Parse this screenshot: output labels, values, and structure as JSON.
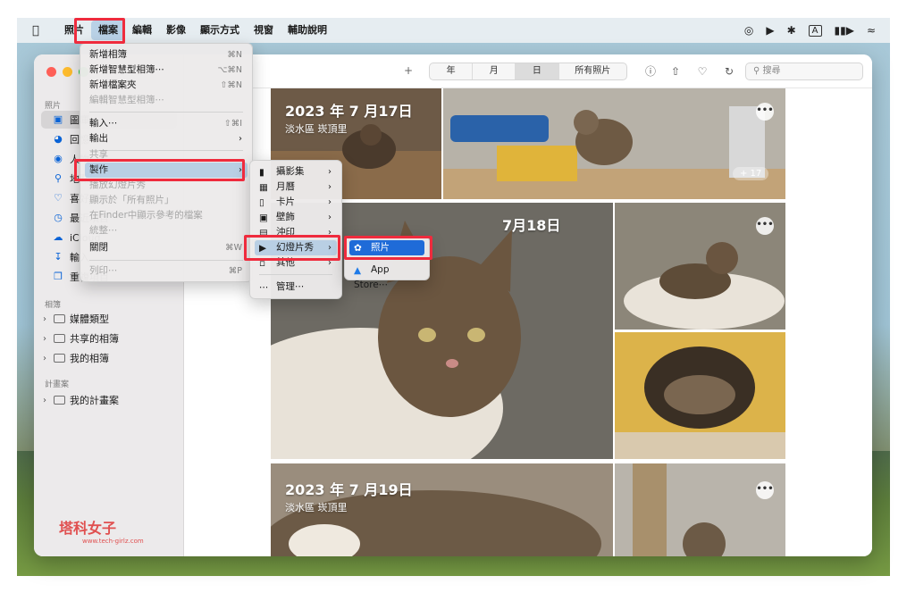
{
  "menubar": {
    "app": "照片",
    "items": [
      "檔案",
      "編輯",
      "影像",
      "顯示方式",
      "視窗",
      "輔助說明"
    ],
    "status_icons": [
      "airplay-icon",
      "play-icon",
      "bluetooth-icon",
      "input-icon",
      "battery-icon",
      "wifi-icon"
    ],
    "input_label": "A"
  },
  "sidebar": {
    "section_photos": "照片",
    "items": [
      {
        "label": "圖庫",
        "icon": "photos-icon"
      },
      {
        "label": "回憶",
        "icon": "memories-icon"
      },
      {
        "label": "人物",
        "icon": "people-icon"
      },
      {
        "label": "地點",
        "icon": "places-icon"
      },
      {
        "label": "喜好項目",
        "icon": "heart-icon"
      },
      {
        "label": "最近項目",
        "icon": "clock-icon"
      },
      {
        "label": "iCloud",
        "icon": "cloud-icon"
      },
      {
        "label": "輸入",
        "icon": "import-icon"
      },
      {
        "label": "重複項目",
        "icon": "duplicate-icon"
      }
    ],
    "section_albums": "相簿",
    "albums": [
      "媒體類型",
      "共享的相簿",
      "我的相簿"
    ],
    "section_projects": "計畫案",
    "projects": [
      "我的計畫案"
    ]
  },
  "toolbar": {
    "segments": [
      "年",
      "月",
      "日",
      "所有照片"
    ],
    "active_segment": "日",
    "search_placeholder": "搜尋"
  },
  "days": [
    {
      "title": "2023 年 7 月17日",
      "location": "淡水區 崁頂里",
      "more_count": "+ 17"
    },
    {
      "title": "7月18日",
      "location": ""
    },
    {
      "title": "2023 年 7 月19日",
      "location": "淡水區 崁頂里"
    }
  ],
  "file_menu": {
    "items": [
      {
        "label": "新增相簿",
        "shortcut": "⌘N",
        "disabled": false
      },
      {
        "label": "新增智慧型相簿⋯",
        "shortcut": "⌥⌘N",
        "disabled": false
      },
      {
        "label": "新增檔案夾",
        "shortcut": "⇧⌘N",
        "disabled": false
      },
      {
        "label": "編輯智慧型相簿⋯",
        "shortcut": "",
        "disabled": true
      },
      {
        "label": "輸入⋯",
        "shortcut": "⇧⌘I",
        "disabled": false
      },
      {
        "label": "輸出",
        "shortcut": "",
        "disabled": false
      },
      {
        "label": "共享",
        "shortcut": "",
        "disabled": true
      },
      {
        "label": "製作",
        "shortcut": "",
        "disabled": false
      },
      {
        "label": "播放幻燈片秀",
        "shortcut": "",
        "disabled": true
      },
      {
        "label": "顯示於「所有照片」",
        "shortcut": "",
        "disabled": true
      },
      {
        "label": "在Finder中顯示參考的檔案",
        "shortcut": "",
        "disabled": true
      },
      {
        "label": "統整⋯",
        "shortcut": "",
        "disabled": true
      },
      {
        "label": "關閉",
        "shortcut": "⌘W",
        "disabled": false
      },
      {
        "label": "列印⋯",
        "shortcut": "⌘P",
        "disabled": true
      }
    ]
  },
  "create_menu": {
    "items": [
      {
        "label": "攝影集",
        "icon": "book-icon"
      },
      {
        "label": "月曆",
        "icon": "calendar-icon"
      },
      {
        "label": "卡片",
        "icon": "card-icon"
      },
      {
        "label": "壁飾",
        "icon": "wall-decor-icon"
      },
      {
        "label": "沖印",
        "icon": "prints-icon"
      },
      {
        "label": "幻燈片秀",
        "icon": "slideshow-icon"
      },
      {
        "label": "其他",
        "icon": "other-icon"
      },
      {
        "label": "管理⋯",
        "icon": "manage-icon"
      }
    ]
  },
  "slideshow_menu": {
    "items": [
      {
        "label": "照片",
        "icon": "photos-app-icon"
      },
      {
        "label": "App Store⋯",
        "icon": "app-store-icon"
      }
    ]
  },
  "watermark": {
    "brand": "塔科女子",
    "url": "www.tech-girlz.com"
  },
  "colors": {
    "highlight": "#ef2b3d",
    "menu_selection": "#1f6bd8",
    "accent": "#0a63d6"
  }
}
